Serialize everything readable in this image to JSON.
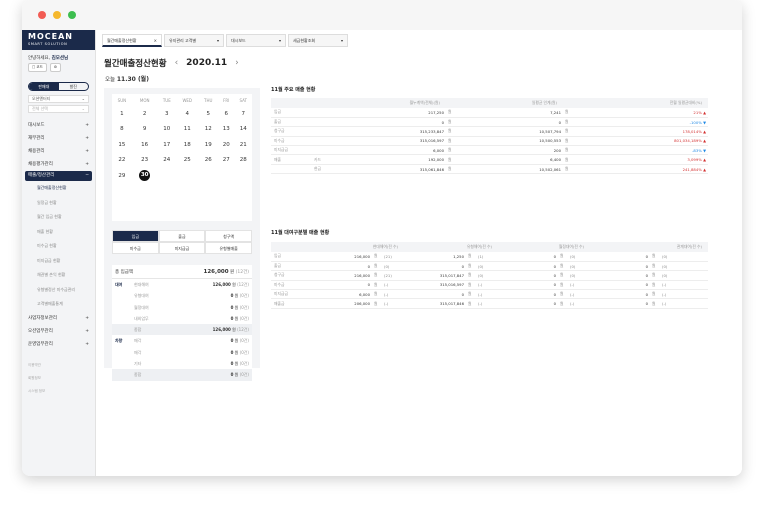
{
  "brand": {
    "name": "MOCEAN",
    "sub": "SMART SOLUTION"
  },
  "user": {
    "greeting": "안녕하세요,",
    "name": "김모션님",
    "btn1": "□ 코드",
    "btn2": "⚙"
  },
  "sidebar": {
    "toggle": [
      "판매대",
      "발진"
    ],
    "select1": "오션엔터티",
    "select2": "전체 선택",
    "items": [
      {
        "label": "대시보드",
        "icon": "+"
      },
      {
        "label": "재무관리",
        "icon": "+"
      },
      {
        "label": "채용관리",
        "icon": "+"
      },
      {
        "label": "채용평가관리",
        "icon": "+"
      },
      {
        "label": "매출/정산관리",
        "icon": "−"
      }
    ],
    "subitems": [
      "월간매출정산현황",
      "일정금 현황",
      "월간 입금 현황",
      "매출 현황",
      "미수금 현황",
      "미지급금 현황",
      "채권별 손익 현황",
      "유형별정산 미수금관리",
      "고객별매출통계"
    ],
    "items2": [
      {
        "label": "사업자정보관리",
        "icon": "+"
      },
      {
        "label": "오션업무관리",
        "icon": "+"
      },
      {
        "label": "운영업무관리",
        "icon": "+"
      }
    ],
    "footer": [
      "이용약관",
      "회원정보",
      "시스템 정보"
    ]
  },
  "tabs": [
    {
      "label": "월간매출정산현황",
      "close": "×"
    },
    {
      "label": "유지관리 고객별",
      "close": "▾"
    },
    {
      "label": "대시보드",
      "close": "▾"
    },
    {
      "label": "세금현황조회",
      "close": "▾"
    }
  ],
  "page": {
    "title": "월간매출정산현황",
    "month": "2020.11",
    "prev": "‹",
    "next": "›",
    "today_label": "오늘",
    "today_value": "11.30 (월)"
  },
  "calendar": {
    "weekdays": [
      "SUN",
      "MON",
      "TUE",
      "WED",
      "THU",
      "FRI",
      "SAT"
    ],
    "weeks": [
      [
        "",
        "1",
        "2",
        "3",
        "4",
        "5",
        "6",
        "7"
      ],
      [
        "",
        "8",
        "9",
        "10",
        "11",
        "12",
        "13",
        "14"
      ],
      [
        "",
        "15",
        "16",
        "17",
        "18",
        "19",
        "20",
        "21"
      ],
      [
        "",
        "22",
        "23",
        "24",
        "25",
        "26",
        "27",
        "28"
      ],
      [
        "",
        "29",
        "30",
        "",
        "",
        "",
        "",
        ""
      ]
    ],
    "today": "30"
  },
  "kind_tabs": [
    "입금",
    "출금",
    "청구액",
    "미수금",
    "미지급금",
    "유형별매출"
  ],
  "summary": {
    "total_label": "총 입금액",
    "total_value": "126,000",
    "total_unit": "원",
    "total_count": "(12건)",
    "rows": [
      {
        "group": "대여",
        "label": "현대해여",
        "value": "126,000",
        "unit": "원",
        "count": "(12건)"
      },
      {
        "group": "",
        "label": "유형대여",
        "value": "0",
        "unit": "원",
        "count": "(0건)"
      },
      {
        "group": "",
        "label": "월정대여",
        "value": "0",
        "unit": "원",
        "count": "(0건)"
      },
      {
        "group": "",
        "label": "내외업무",
        "value": "0",
        "unit": "원",
        "count": "(0건)"
      },
      {
        "group": "",
        "label": "종합",
        "value": "126,000",
        "unit": "원",
        "count": "(12건)"
      },
      {
        "group": "차량",
        "label": "매각",
        "value": "0",
        "unit": "원",
        "count": "(0건)"
      },
      {
        "group": "",
        "label": "매각",
        "value": "0",
        "unit": "원",
        "count": "(0건)"
      },
      {
        "group": "",
        "label": "기타",
        "value": "0",
        "unit": "원",
        "count": "(0건)"
      },
      {
        "group": "",
        "label": "종합",
        "value": "0",
        "unit": "원",
        "count": "(0건)"
      }
    ]
  },
  "table1": {
    "title": "11월 주요 매출 현황",
    "headers": [
      "",
      "",
      "월누계액(전체)(원)",
      "",
      "일평균 인계(원)",
      "",
      "전월 일평균대비(%)"
    ],
    "rows": [
      {
        "a": "입금",
        "b": "",
        "v1": "217,250",
        "u1": "원",
        "v2": "7,241",
        "u2": "원",
        "pct": "21% ▲",
        "dir": "up"
      },
      {
        "a": "출금",
        "b": "",
        "v1": "0",
        "u1": "원",
        "v2": "0",
        "u2": "원",
        "pct": "-100% ▼",
        "dir": "dn"
      },
      {
        "a": "청구금",
        "b": "",
        "v1": "315,233,847",
        "u1": "원",
        "v2": "10,507,794",
        "u2": "원",
        "pct": "178,014% ▲",
        "dir": "up"
      },
      {
        "a": "미수금",
        "b": "",
        "v1": "315,016,597",
        "u1": "원",
        "v2": "10,500,553",
        "u2": "원",
        "pct": "801,034,189% ▲",
        "dir": "up"
      },
      {
        "a": "미지급금",
        "b": "",
        "v1": "6,000",
        "u1": "원",
        "v2": "200",
        "u2": "원",
        "pct": "-83% ▼",
        "dir": "dn"
      },
      {
        "a": "",
        "b": "카드",
        "v1": "192,000",
        "u1": "원",
        "v2": "6,400",
        "u2": "원",
        "pct": "3,099% ▲",
        "dir": "up"
      },
      {
        "a": "",
        "b": "현금",
        "v1": "315,061,846",
        "u1": "원",
        "v2": "10,502,061",
        "u2": "원",
        "pct": "241,884% ▲",
        "dir": "up"
      }
    ],
    "group_label": "매출"
  },
  "table2": {
    "title": "11월 대여구분별 매출 현황",
    "headers": [
      "",
      "현대해여(전 수)",
      "유형해여(전 수)",
      "월정대여(전 수)",
      "관계대여(전 수)"
    ],
    "rows": [
      {
        "label": "입금",
        "c": [
          [
            "216,000",
            "원",
            "(21)"
          ],
          [
            "1,250",
            "원",
            "(1)"
          ],
          [
            "0",
            "원",
            "(0)"
          ],
          [
            "0",
            "원",
            "(0)"
          ]
        ]
      },
      {
        "label": "출금",
        "c": [
          [
            "0",
            "원",
            "(0)"
          ],
          [
            "0",
            "원",
            "(0)"
          ],
          [
            "0",
            "원",
            "(0)"
          ],
          [
            "0",
            "원",
            "(0)"
          ]
        ]
      },
      {
        "label": "청구금",
        "c": [
          [
            "216,000",
            "원",
            "(21)"
          ],
          [
            "315,017,847",
            "원",
            "(0)"
          ],
          [
            "0",
            "원",
            "(0)"
          ],
          [
            "0",
            "원",
            "(0)"
          ]
        ]
      },
      {
        "label": "미수금",
        "c": [
          [
            "0",
            "원",
            "(-)"
          ],
          [
            "315,016,597",
            "원",
            "(-)"
          ],
          [
            "0",
            "원",
            "(-)"
          ],
          [
            "0",
            "원",
            "(-)"
          ]
        ]
      },
      {
        "label": "미지급금",
        "c": [
          [
            "6,000",
            "원",
            "(-)"
          ],
          [
            "0",
            "원",
            "(-)"
          ],
          [
            "0",
            "원",
            "(-)"
          ],
          [
            "0",
            "원",
            "(-)"
          ]
        ]
      },
      {
        "label": "매출금",
        "c": [
          [
            "206,000",
            "원",
            "(-)"
          ],
          [
            "315,017,846",
            "원",
            "(-)"
          ],
          [
            "0",
            "원",
            "(-)"
          ],
          [
            "0",
            "원",
            "(-)"
          ]
        ]
      }
    ]
  },
  "colors": {
    "navy": "#1b2a4a",
    "up": "#d32f2f",
    "down": "#1e88e5",
    "dot_red": "#f25c54",
    "dot_yellow": "#f5b82e",
    "dot_green": "#3dbe4f"
  }
}
